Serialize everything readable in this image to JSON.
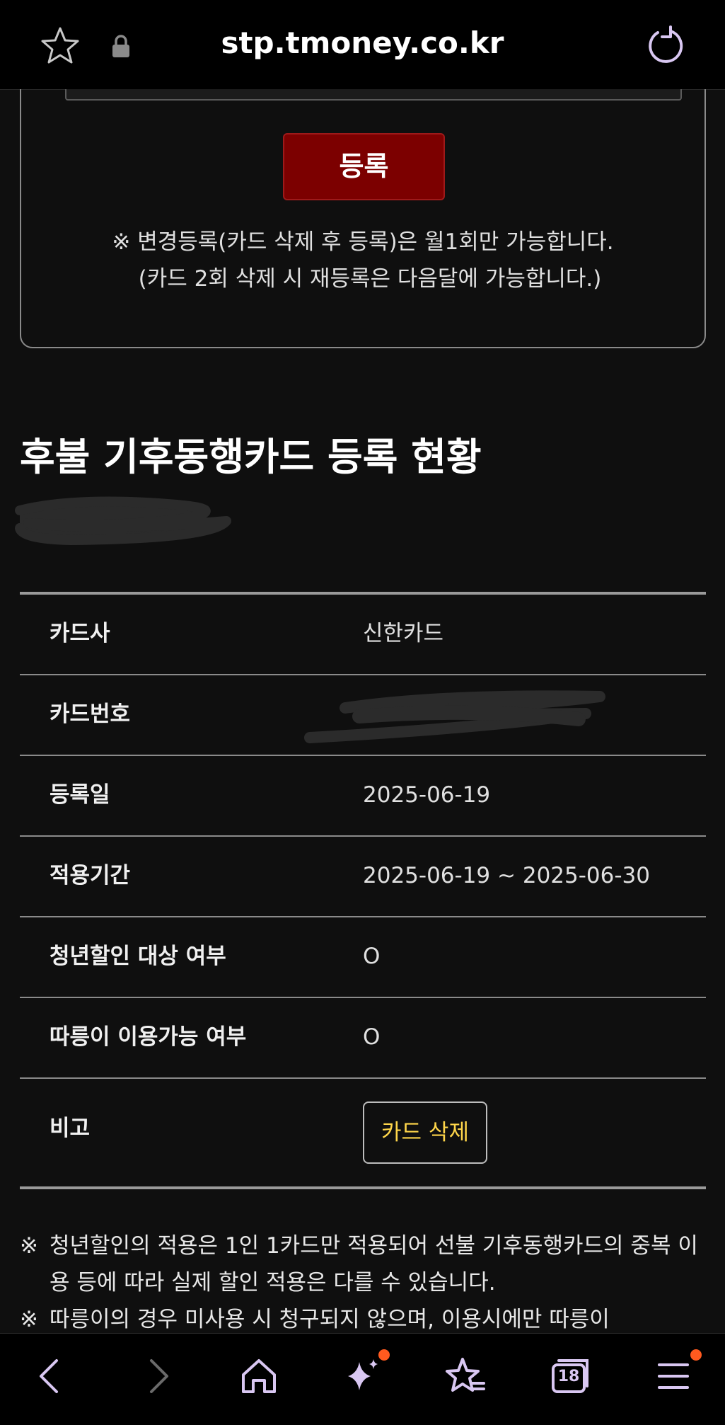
{
  "browser": {
    "url": "stp.tmoney.co.kr",
    "nav_badge_count": "18"
  },
  "register": {
    "button_label": "등록",
    "notice_line1": "※ 변경등록(카드 삭제 후 등록)은 월1회만 가능합니다.",
    "notice_line2": "(카드 2회 삭제 시 재등록은 다음달에 가능합니다.)"
  },
  "status": {
    "title": "후불 기후동행카드 등록 현황",
    "rows": [
      {
        "label": "카드사",
        "value": "신한카드"
      },
      {
        "label": "카드번호",
        "value": ""
      },
      {
        "label": "등록일",
        "value": "2025-06-19"
      },
      {
        "label": "적용기간",
        "value": "2025-06-19 ~ 2025-06-30"
      },
      {
        "label": "청년할인 대상 여부",
        "value": "O"
      },
      {
        "label": "따릉이 이용가능 여부",
        "value": "O"
      },
      {
        "label": "비고",
        "value": ""
      }
    ],
    "delete_button": "카드 삭제"
  },
  "notes": {
    "mark": "※",
    "note1": "청년할인의 적용은 1인 1카드만 적용되어 선불 기후동행카드의 중복 이용 등에 따라 실제 할인 적용은 다를 수 있습니다.",
    "note2": "따릉이의 경우 미사용 시 청구되지 않으며, 이용시에만 따릉이"
  },
  "colors": {
    "accent_button": "#7c0000",
    "delete_text": "#ffd64a",
    "notification_dot": "#ff5a1f",
    "icon_lavender": "#d9c7f2"
  }
}
